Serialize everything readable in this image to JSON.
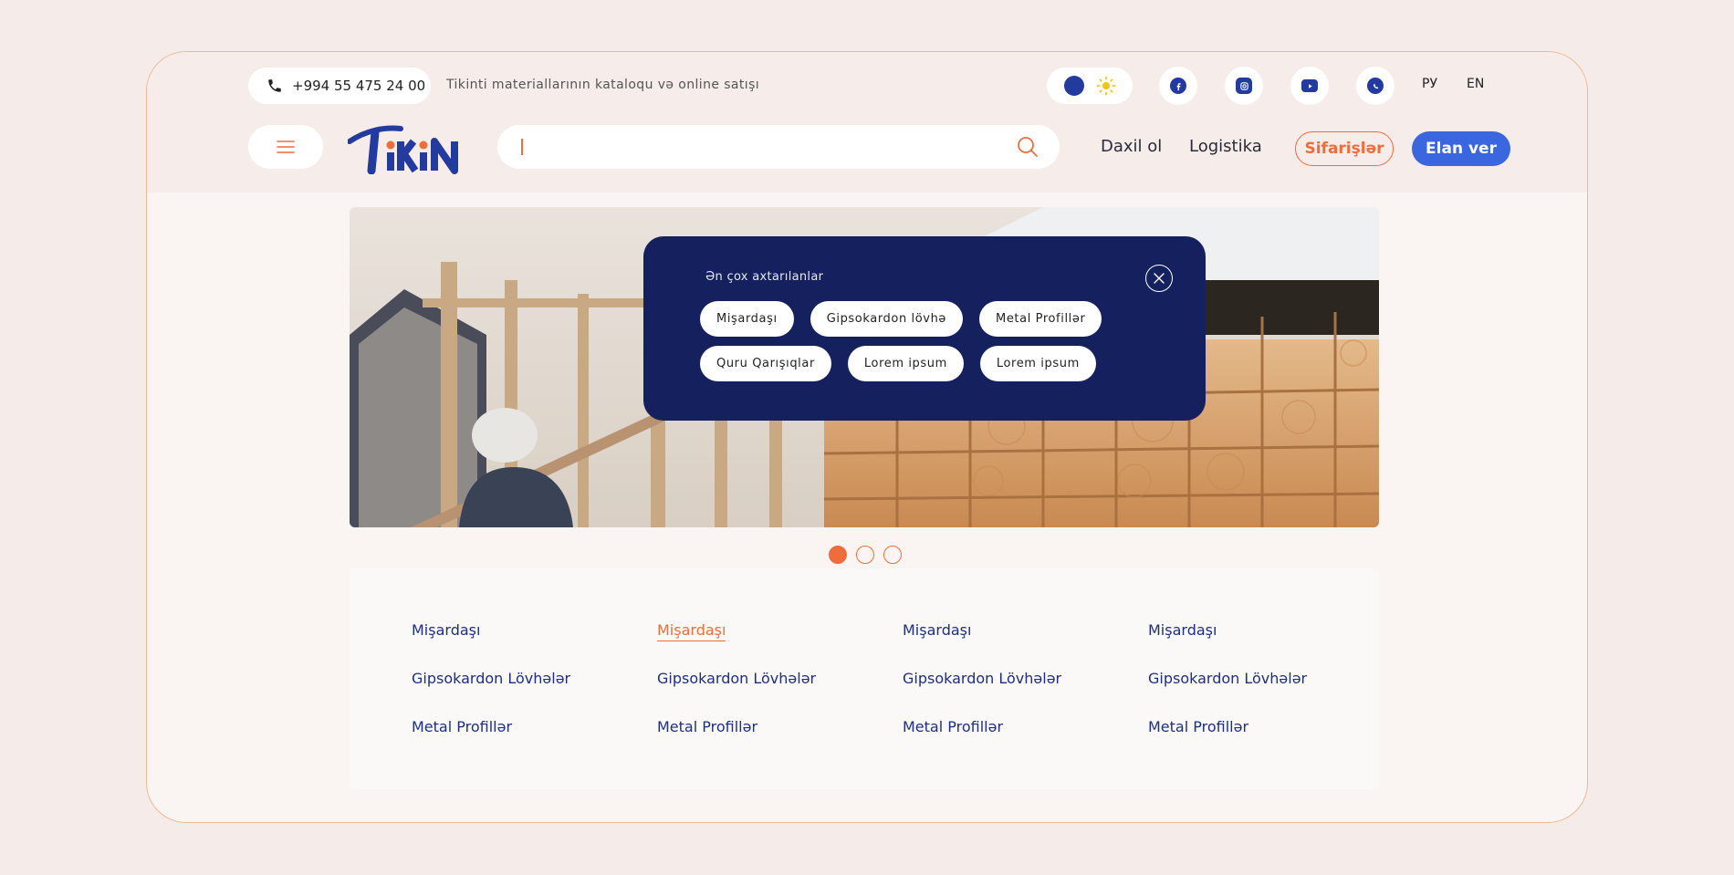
{
  "topbar": {
    "phone": "+994 55 475 24 00",
    "tagline": "Tikinti materiallarının kataloqu və online satışı",
    "social": [
      "facebook-icon",
      "instagram-icon",
      "youtube-icon",
      "whatsapp-icon"
    ],
    "languages": [
      "РУ",
      "EN"
    ]
  },
  "header": {
    "logo_text": "TIKIN",
    "search_placeholder": "",
    "nav": {
      "login": "Daxil ol",
      "logistics": "Logistika",
      "orders": "Sifarişlər",
      "post_ad": "Elan ver"
    }
  },
  "popular": {
    "title": "Ən çox axtarılanlar",
    "chips": [
      "Mişardaşı",
      "Gipsokardon lövhə",
      "Metal Profillər",
      "Quru Qarışıqlar",
      "Lorem ipsum",
      "Lorem ipsum"
    ]
  },
  "hero": {
    "slides": 3,
    "active_slide": 1
  },
  "categories": {
    "columns": [
      [
        "Mişardaşı",
        "Gipsokardon Lövhələr",
        "Metal Profillər"
      ],
      [
        "Mişardaşı",
        "Gipsokardon Lövhələr",
        "Metal Profillər"
      ],
      [
        "Mişardaşı",
        "Gipsokardon Lövhələr",
        "Metal Profillər"
      ],
      [
        "Mişardaşı",
        "Gipsokardon Lövhələr",
        "Metal Profillər"
      ]
    ],
    "active": {
      "column": 1,
      "row": 0
    }
  },
  "colors": {
    "accent": "#ee6d3c",
    "brand": "#233a9e",
    "panel": "#14215e",
    "primary_button": "#3a66e0"
  }
}
